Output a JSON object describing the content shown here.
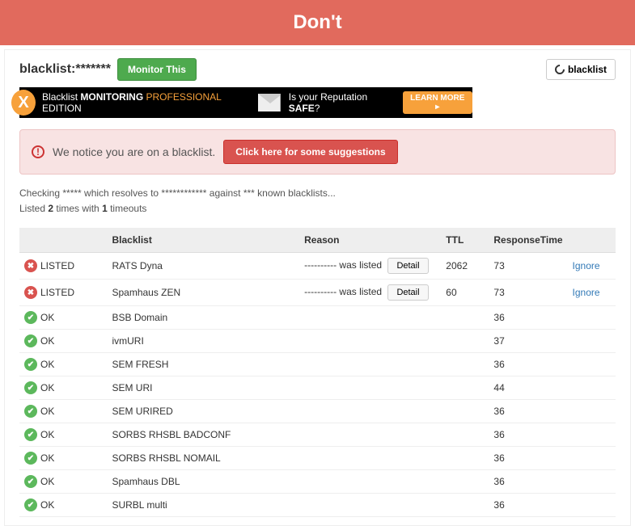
{
  "banner": {
    "title": "Don't"
  },
  "header": {
    "title": "blacklist:*******",
    "monitor_btn": "Monitor This",
    "refresh_btn": "blacklist"
  },
  "promo": {
    "x": "X",
    "part1_pre": "Blacklist ",
    "part1_mon": "MONITORING",
    "part1_pro": " PROFESSIONAL",
    "part1_ed": " EDITION",
    "part2_pre": "Is your Reputation ",
    "part2_safe": "SAFE",
    "part2_post": "?",
    "learn_more": "LEARN MORE ▸"
  },
  "alert": {
    "icon": "!",
    "text": "We notice you are on a blacklist.",
    "cta": "Click here for some suggestions"
  },
  "summary": {
    "line1": "Checking ***** which resolves to ************ against *** known blacklists...",
    "line2_pre": "Listed ",
    "line2_count": "2",
    "line2_mid": " times with ",
    "line2_t": "1",
    "line2_post": " timeouts"
  },
  "table": {
    "headers": {
      "status": "",
      "blacklist": "Blacklist",
      "reason": "Reason",
      "ttl": "TTL",
      "rt": "ResponseTime",
      "action": ""
    },
    "rows": [
      {
        "listed": true,
        "status": "LISTED",
        "blacklist": "RATS Dyna",
        "reason": "---------- was listed",
        "detail": "Detail",
        "ttl": "2062",
        "rt": "73",
        "action": "Ignore"
      },
      {
        "listed": true,
        "status": "LISTED",
        "blacklist": "Spamhaus ZEN",
        "reason": "---------- was listed",
        "detail": "Detail",
        "ttl": "60",
        "rt": "73",
        "action": "Ignore"
      },
      {
        "listed": false,
        "status": "OK",
        "blacklist": "BSB Domain",
        "reason": "",
        "ttl": "",
        "rt": "36",
        "action": ""
      },
      {
        "listed": false,
        "status": "OK",
        "blacklist": "ivmURI",
        "reason": "",
        "ttl": "",
        "rt": "37",
        "action": ""
      },
      {
        "listed": false,
        "status": "OK",
        "blacklist": "SEM FRESH",
        "reason": "",
        "ttl": "",
        "rt": "36",
        "action": ""
      },
      {
        "listed": false,
        "status": "OK",
        "blacklist": "SEM URI",
        "reason": "",
        "ttl": "",
        "rt": "44",
        "action": ""
      },
      {
        "listed": false,
        "status": "OK",
        "blacklist": "SEM URIRED",
        "reason": "",
        "ttl": "",
        "rt": "36",
        "action": ""
      },
      {
        "listed": false,
        "status": "OK",
        "blacklist": "SORBS RHSBL BADCONF",
        "reason": "",
        "ttl": "",
        "rt": "36",
        "action": ""
      },
      {
        "listed": false,
        "status": "OK",
        "blacklist": "SORBS RHSBL NOMAIL",
        "reason": "",
        "ttl": "",
        "rt": "36",
        "action": ""
      },
      {
        "listed": false,
        "status": "OK",
        "blacklist": "Spamhaus DBL",
        "reason": "",
        "ttl": "",
        "rt": "36",
        "action": ""
      },
      {
        "listed": false,
        "status": "OK",
        "blacklist": "SURBL multi",
        "reason": "",
        "ttl": "",
        "rt": "36",
        "action": ""
      }
    ]
  }
}
